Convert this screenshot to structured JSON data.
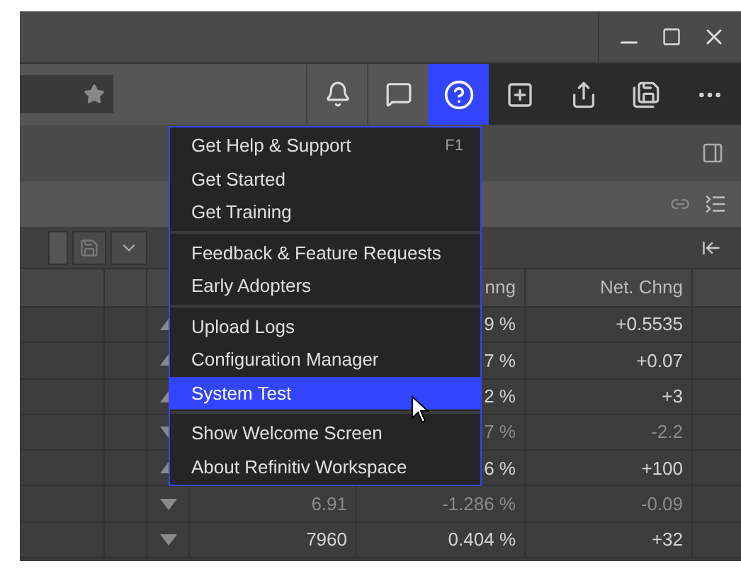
{
  "toolbar": {
    "help_active": true
  },
  "table": {
    "header": {
      "column_5": "nng",
      "column_6": "Net. Chng"
    },
    "rows": [
      {
        "kind": "up",
        "dimmed": false,
        "column_4": "",
        "column_5": "9 %",
        "column_6": "+0.5535"
      },
      {
        "kind": "up",
        "dimmed": false,
        "column_4": "",
        "column_5": "7 %",
        "column_6": "+0.07"
      },
      {
        "kind": "up",
        "dimmed": false,
        "column_4": "",
        "column_5": "2 %",
        "column_6": "+3"
      },
      {
        "kind": "down",
        "dimmed": true,
        "column_4": "",
        "column_5": "7 %",
        "column_6": "-2.2"
      },
      {
        "kind": "up",
        "dimmed": false,
        "column_4": "",
        "column_5": "6 %",
        "column_6": "+100"
      },
      {
        "kind": "down",
        "dimmed": true,
        "column_4": "6.91",
        "column_5": "-1.286 %",
        "column_6": "-0.09"
      },
      {
        "kind": "down",
        "dimmed": false,
        "column_4": "7960",
        "column_5": "0.404 %",
        "column_6": "+32"
      }
    ]
  },
  "help_menu": {
    "groups": [
      [
        {
          "label": "Get Help & Support",
          "shortcut": "F1",
          "selected": false
        },
        {
          "label": "Get Started",
          "selected": false
        },
        {
          "label": "Get Training",
          "selected": false
        }
      ],
      [
        {
          "label": "Feedback & Feature Requests",
          "selected": false
        },
        {
          "label": "Early Adopters",
          "selected": false
        }
      ],
      [
        {
          "label": "Upload Logs",
          "selected": false
        },
        {
          "label": "Configuration Manager",
          "selected": false
        },
        {
          "label": "System Test",
          "selected": true
        }
      ],
      [
        {
          "label": "Show Welcome Screen",
          "selected": false
        },
        {
          "label": "About Refinitiv Workspace",
          "selected": false
        }
      ]
    ]
  }
}
